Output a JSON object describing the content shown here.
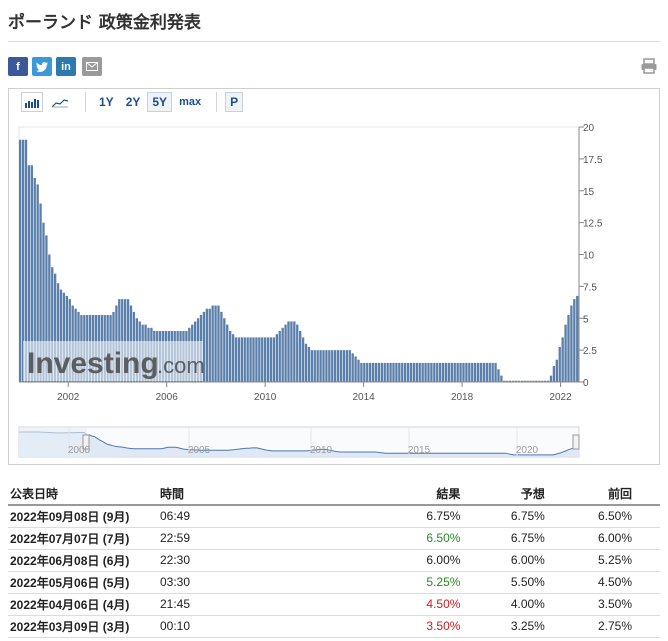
{
  "page": {
    "title": "ポーランド 政策金利発表"
  },
  "share": {
    "facebook": "f",
    "twitter": "twitter-icon",
    "linkedin": "in",
    "email": "mail-icon",
    "print": "printer-icon"
  },
  "toolbar": {
    "ranges": [
      "1Y",
      "2Y",
      "5Y",
      "max"
    ],
    "active_range": "5Y",
    "p_button": "P"
  },
  "colors": {
    "bar": "#5b7fab",
    "navigator_fill": "#dbe6f3",
    "navigator_line": "#4a79b4",
    "link": "#1a4e8a",
    "green": "#2a8a24",
    "red": "#d51a1a"
  },
  "chart_data": {
    "type": "bar",
    "watermark": {
      "main": "Investing",
      "suffix": ".com"
    },
    "ylim": [
      0,
      20
    ],
    "y_ticks": [
      "20",
      "17.5",
      "15",
      "12.5",
      "10",
      "7.5",
      "5",
      "2.5",
      "0"
    ],
    "x_ticks": [
      "2002",
      "2006",
      "2010",
      "2014",
      "2018",
      "2022"
    ],
    "x_range": [
      2000.0,
      2022.75
    ],
    "x_tick_years": [
      2002,
      2006,
      2010,
      2014,
      2018,
      2022
    ],
    "values": [
      19,
      19,
      19,
      17,
      17,
      16,
      15.5,
      14,
      12.5,
      11.5,
      10,
      9,
      8.5,
      7.75,
      7.25,
      7,
      6.75,
      6.5,
      6,
      5.75,
      5.5,
      5.25,
      5.25,
      5.25,
      5.25,
      5.25,
      5.25,
      5.25,
      5.25,
      5.25,
      5.25,
      5.25,
      5.5,
      6,
      6.5,
      6.5,
      6.5,
      6.5,
      6,
      5.5,
      5,
      4.75,
      4.5,
      4.5,
      4.25,
      4.25,
      4,
      4,
      4,
      4,
      4,
      4,
      4,
      4,
      4,
      4,
      4,
      4,
      4.25,
      4.5,
      4.75,
      5,
      5.25,
      5.5,
      5.75,
      5.75,
      6,
      6,
      6,
      5.5,
      5,
      4.5,
      4,
      3.75,
      3.5,
      3.5,
      3.5,
      3.5,
      3.5,
      3.5,
      3.5,
      3.5,
      3.5,
      3.5,
      3.5,
      3.5,
      3.5,
      3.5,
      3.75,
      4,
      4.25,
      4.5,
      4.75,
      4.75,
      4.75,
      4.5,
      4,
      3.5,
      3,
      2.75,
      2.5,
      2.5,
      2.5,
      2.5,
      2.5,
      2.5,
      2.5,
      2.5,
      2.5,
      2.5,
      2.5,
      2.5,
      2.5,
      2.5,
      2.25,
      2,
      1.75,
      1.5,
      1.5,
      1.5,
      1.5,
      1.5,
      1.5,
      1.5,
      1.5,
      1.5,
      1.5,
      1.5,
      1.5,
      1.5,
      1.5,
      1.5,
      1.5,
      1.5,
      1.5,
      1.5,
      1.5,
      1.5,
      1.5,
      1.5,
      1.5,
      1.5,
      1.5,
      1.5,
      1.5,
      1.5,
      1.5,
      1.5,
      1.5,
      1.5,
      1.5,
      1.5,
      1.5,
      1.5,
      1.5,
      1.5,
      1.5,
      1.5,
      1.5,
      1.5,
      1.5,
      1.5,
      1.5,
      1.5,
      1.0,
      0.5,
      0.1,
      0.1,
      0.1,
      0.1,
      0.1,
      0.1,
      0.1,
      0.1,
      0.1,
      0.1,
      0.1,
      0.1,
      0.1,
      0.1,
      0.1,
      0.1,
      0.5,
      1.25,
      1.75,
      2.75,
      3.5,
      4.5,
      5.25,
      6.0,
      6.5,
      6.75
    ],
    "navigator": {
      "x_ticks": [
        "2000",
        "2005",
        "2010",
        "2015",
        "2020"
      ]
    }
  },
  "table": {
    "headers": {
      "date": "公表日時",
      "time": "時間",
      "actual": "結果",
      "forecast": "予想",
      "previous": "前回"
    },
    "rows": [
      {
        "date": "2022年09月08日 (9月)",
        "time": "06:49",
        "actual": "6.75%",
        "actual_color": "",
        "forecast": "6.75%",
        "previous": "6.50%"
      },
      {
        "date": "2022年07月07日 (7月)",
        "time": "22:59",
        "actual": "6.50%",
        "actual_color": "green",
        "forecast": "6.75%",
        "previous": "6.00%"
      },
      {
        "date": "2022年06月08日 (6月)",
        "time": "22:30",
        "actual": "6.00%",
        "actual_color": "",
        "forecast": "6.00%",
        "previous": "5.25%"
      },
      {
        "date": "2022年05月06日 (5月)",
        "time": "03:30",
        "actual": "5.25%",
        "actual_color": "green",
        "forecast": "5.50%",
        "previous": "4.50%"
      },
      {
        "date": "2022年04月06日 (4月)",
        "time": "21:45",
        "actual": "4.50%",
        "actual_color": "red",
        "forecast": "4.00%",
        "previous": "3.50%"
      },
      {
        "date": "2022年03月09日 (3月)",
        "time": "00:10",
        "actual": "3.50%",
        "actual_color": "red",
        "forecast": "3.25%",
        "previous": "2.75%"
      }
    ]
  }
}
